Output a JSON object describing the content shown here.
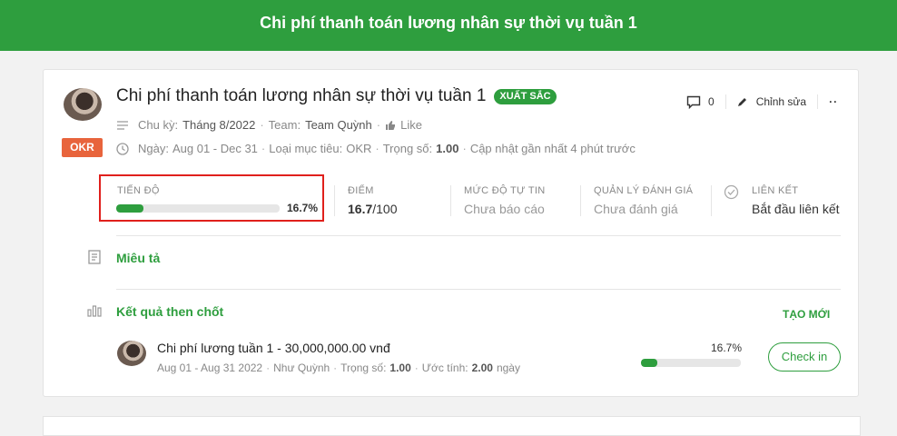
{
  "header": {
    "title": "Chi phí thanh toán lương nhân sự thời vụ tuần 1"
  },
  "objective": {
    "type_badge": "OKR",
    "title": "Chi phí thanh toán lương nhân sự thời vụ tuần 1",
    "status_badge": "XUẤT SẮC",
    "comment_count": "0",
    "edit_label": "Chỉnh sửa",
    "more_label": "··",
    "cycle_label": "Chu kỳ:",
    "cycle_value": "Tháng 8/2022",
    "team_label": "Team:",
    "team_value": "Team Quỳnh",
    "like_label": "Like",
    "date_label": "Ngày:",
    "date_value": "Aug 01 - Dec 31",
    "goal_type_label": "Loại mục tiêu:",
    "goal_type_value": "OKR",
    "weight_label": "Trọng số:",
    "weight_value": "1.00",
    "updated_text": "Cập nhật gần nhất 4 phút trước",
    "dot": "·"
  },
  "stats": {
    "progress_label": "TIẾN ĐỘ",
    "progress_value": 16.7,
    "progress_text": "16.7%",
    "score_label": "ĐIỂM",
    "score_value": "16.7",
    "score_total": "/100",
    "confidence_label": "MỨC ĐỘ TỰ TIN",
    "confidence_value": "Chưa báo cáo",
    "review_label": "QUẢN LÝ ĐÁNH GIÁ",
    "review_value": "Chưa đánh giá",
    "link_label": "LIÊN KẾT",
    "link_value": "Bắt đầu liên kết"
  },
  "description": {
    "title": "Miêu tả"
  },
  "key_results": {
    "title": "Kết quả then chốt",
    "create_label": "TẠO MỚI",
    "items": [
      {
        "title": "Chi phí lương tuần 1 - 30,000,000.00 vnđ",
        "date": "Aug 01 - Aug 31 2022",
        "owner": "Như Quỳnh",
        "weight_label": "Trọng số:",
        "weight": "1.00",
        "estimate_label": "Ước tính:",
        "estimate": "2.00",
        "estimate_unit": "ngày",
        "progress_value": 16.7,
        "progress_text": "16.7%",
        "checkin_label": "Check in"
      }
    ]
  },
  "colors": {
    "primary": "#2e9e3e",
    "okr_badge": "#e8643c",
    "highlight": "#e0201c"
  }
}
